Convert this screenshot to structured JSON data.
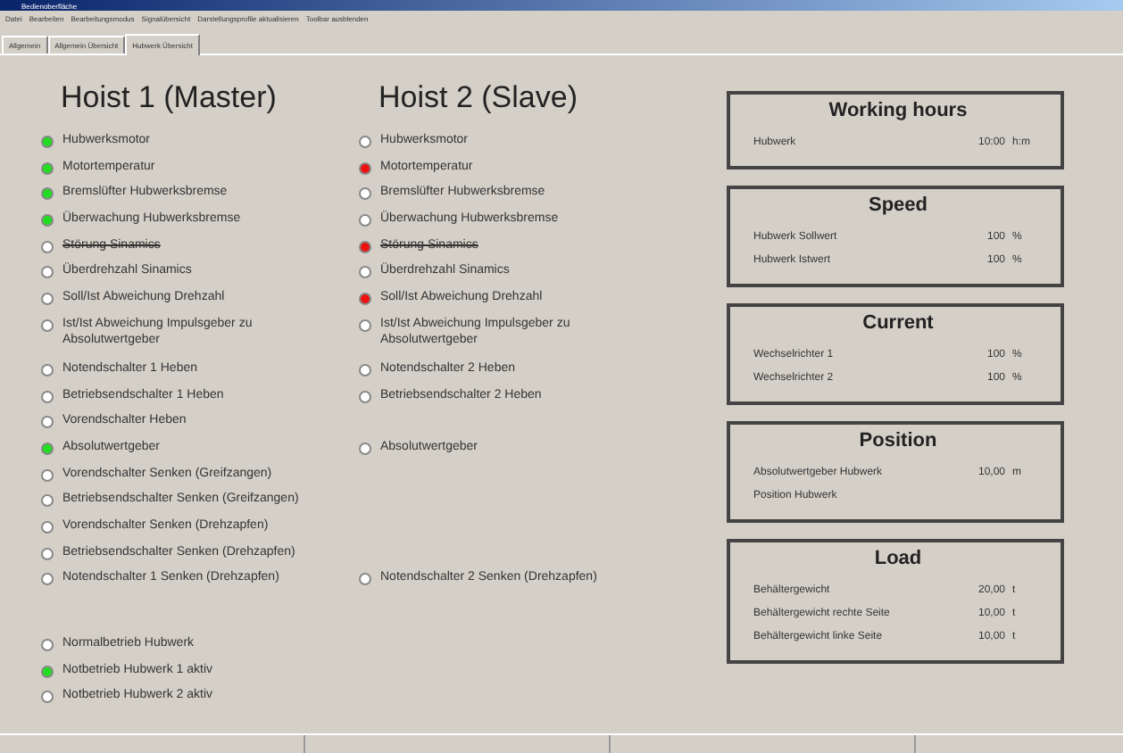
{
  "window": {
    "title": "Bedienoberfläche"
  },
  "menu": [
    "Datei",
    "Bearbeiten",
    "Bearbeitungsmodus",
    "Signalübersicht",
    "Darstellungsprofile aktualisieren",
    "Toolbar ausblenden"
  ],
  "tabs": [
    {
      "label": "Allgemein",
      "selected": false
    },
    {
      "label": "Allgemein Übersicht",
      "selected": false
    },
    {
      "label": "Hubwerk Übersicht",
      "selected": true
    }
  ],
  "hoists": [
    {
      "title": "Hoist 1 (Master)"
    },
    {
      "title": "Hoist 2 (Slave)"
    }
  ],
  "status_groups": [
    {
      "rows": [
        {
          "master": {
            "label": "Hubwerksmotor",
            "on": true,
            "fault": false
          },
          "slave": {
            "label": "Hubwerksmotor",
            "on": false
          }
        },
        {
          "master": {
            "label": "Motortemperatur",
            "on": true,
            "fault": false
          },
          "slave": {
            "label": "Motortemperatur",
            "on": true,
            "fault": true
          }
        },
        {
          "master": {
            "label": "Bremslüfter Hubwerksbremse",
            "on": true,
            "fault": false
          },
          "slave": {
            "label": "Bremslüfter Hubwerksbremse",
            "on": false
          }
        },
        {
          "master": {
            "label": "Überwachung Hubwerksbremse",
            "on": true,
            "fault": false
          },
          "slave": {
            "label": "Überwachung Hubwerksbremse",
            "on": false
          }
        },
        {
          "master": {
            "label": "Störung Sinamics",
            "on": false,
            "struck": true
          },
          "slave": {
            "label": "Störung Sinamics",
            "on": true,
            "fault": true,
            "struck": true
          }
        },
        {
          "master": {
            "label": "Überdrehzahl Sinamics",
            "on": false
          },
          "slave": {
            "label": "Überdrehzahl Sinamics",
            "on": false
          }
        },
        {
          "master": {
            "label": "Soll/Ist Abweichung Drehzahl",
            "on": false
          },
          "slave": {
            "label": "Soll/Ist Abweichung Drehzahl",
            "on": true,
            "fault": true
          }
        },
        {
          "master": {
            "label": "Ist/Ist Abweichung Impulsgeber zu Absolutwertgeber",
            "on": false
          },
          "slave": {
            "label": "Ist/Ist Abweichung Impulsgeber zu Absolutwertgeber",
            "on": false
          }
        }
      ]
    },
    {
      "rows": [
        {
          "master": {
            "label": "Notendschalter 1 Heben",
            "on": false
          },
          "slave": {
            "label": "Notendschalter 2 Heben",
            "on": false
          }
        },
        {
          "master": {
            "label": "Betriebsendschalter 1 Heben",
            "on": false
          },
          "slave": {
            "label": "Betriebsendschalter 2 Heben",
            "on": false
          }
        },
        {
          "master": {
            "label": "Vorendschalter Heben",
            "on": false
          }
        },
        {
          "master": {
            "label": "Absolutwertgeber",
            "on": true,
            "fault": false
          },
          "slave": {
            "label": "Absolutwertgeber",
            "on": false
          }
        },
        {
          "master": {
            "label": "Vorendschalter Senken (Greifzangen)",
            "on": false
          }
        },
        {
          "master": {
            "label": "Betriebsendschalter Senken (Greifzangen)",
            "on": false
          }
        },
        {
          "master": {
            "label": "Vorendschalter Senken (Drehzapfen)",
            "on": false
          }
        },
        {
          "master": {
            "label": "Betriebsendschalter Senken (Drehzapfen)",
            "on": false
          }
        },
        {
          "master": {
            "label": "Notendschalter 1 Senken (Drehzapfen)",
            "on": false
          },
          "slave": {
            "label": "Notendschalter 2 Senken (Drehzapfen)",
            "on": false
          }
        }
      ]
    },
    {
      "rows": [
        {
          "master": {
            "label": "Normalbetrieb Hubwerk",
            "on": false
          }
        },
        {
          "master": {
            "label": "Notbetrieb Hubwerk 1 aktiv",
            "on": true,
            "fault": false
          }
        },
        {
          "master": {
            "label": "Notbetrieb Hubwerk 2 aktiv",
            "on": false
          }
        }
      ]
    }
  ],
  "panels": [
    {
      "title": "Working hours",
      "rows": [
        {
          "label": "Hubwerk",
          "value": "10:00",
          "unit": "h:m"
        }
      ]
    },
    {
      "title": "Speed",
      "rows": [
        {
          "label": "Hubwerk Sollwert",
          "value": "100",
          "unit": "%"
        },
        {
          "label": "Hubwerk Istwert",
          "value": "100",
          "unit": "%"
        }
      ]
    },
    {
      "title": "Current",
      "rows": [
        {
          "label": "Wechselrichter 1",
          "value": "100",
          "unit": "%"
        },
        {
          "label": "Wechselrichter 2",
          "value": "100",
          "unit": "%"
        }
      ]
    },
    {
      "title": "Position",
      "rows": [
        {
          "label": "Absolutwertgeber Hubwerk",
          "value": "10,00",
          "unit": "m"
        },
        {
          "label": "Position Hubwerk"
        }
      ]
    },
    {
      "title": "Load",
      "rows": [
        {
          "label": "Behältergewicht",
          "value": "20,00",
          "unit": "t"
        },
        {
          "label": "Behältergewicht rechte Seite",
          "value": "10,00",
          "unit": "t"
        },
        {
          "label": "Behältergewicht linke Seite",
          "value": "10,00",
          "unit": "t"
        }
      ]
    }
  ]
}
